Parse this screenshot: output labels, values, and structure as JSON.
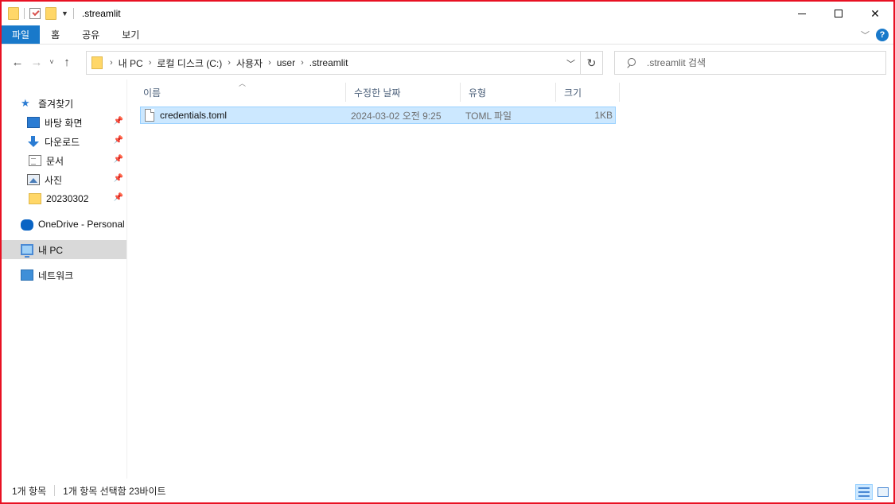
{
  "window": {
    "title": ".streamlit"
  },
  "ribbon": {
    "tabs": [
      "파일",
      "홈",
      "공유",
      "보기"
    ]
  },
  "address": {
    "crumbs": [
      "내 PC",
      "로컬 디스크 (C:)",
      "사용자",
      "user",
      ".streamlit"
    ]
  },
  "search": {
    "placeholder": ".streamlit 검색"
  },
  "nav": {
    "quick_access": "즐겨찾기",
    "items": [
      "바탕 화면",
      "다운로드",
      "문서",
      "사진",
      "20230302"
    ],
    "onedrive": "OneDrive - Personal",
    "this_pc": "내 PC",
    "network": "네트워크"
  },
  "columns": {
    "name": "이름",
    "date": "수정한 날짜",
    "type": "유형",
    "size": "크기"
  },
  "files": [
    {
      "name": "credentials.toml",
      "date": "2024-03-02 오전 9:25",
      "type": "TOML 파일",
      "size": "1KB"
    }
  ],
  "status": {
    "count": "1개 항목",
    "selection": "1개 항목 선택함 23바이트"
  },
  "colors": {
    "accent": "#1979ca",
    "selection_bg": "#cce8ff",
    "border_red": "#e81123"
  }
}
